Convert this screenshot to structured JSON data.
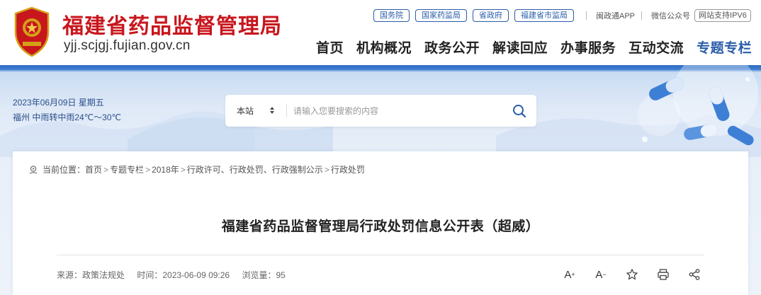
{
  "header": {
    "site_title": "福建省药品监督管理局",
    "domain": "yjj.scjgj.fujian.gov.cn",
    "top_links": [
      "国务院",
      "国家药监局",
      "省政府",
      "福建省市监局"
    ],
    "app_text": "闽政通APP",
    "wechat_text": "微信公众号",
    "ipv6_text": "网站支持IPV6",
    "nav": [
      "首页",
      "机构概况",
      "政务公开",
      "解读回应",
      "办事服务",
      "互动交流",
      "专题专栏"
    ],
    "active_nav": "专题专栏"
  },
  "banner": {
    "date": "2023年06月09日 星期五",
    "weather": "福州 中雨转中雨24℃～30℃"
  },
  "search": {
    "scope": "本站",
    "placeholder": "请输入您要搜索的内容"
  },
  "breadcrumb": {
    "label": "当前位置：",
    "items": [
      "首页",
      "专题专栏",
      "2018年",
      "行政许可、行政处罚、行政强制公示",
      "行政处罚"
    ],
    "separator": ">"
  },
  "article": {
    "title": "福建省药品监督管理局行政处罚信息公开表（超威）",
    "source": "来源：政策法规处",
    "time": "时间：2023-06-09 09:26",
    "views": "浏览量：95"
  },
  "tools": {
    "font_increase": "A",
    "font_decrease": "A"
  },
  "colors": {
    "brand_red": "#c8161d",
    "brand_blue": "#2a5caa"
  }
}
